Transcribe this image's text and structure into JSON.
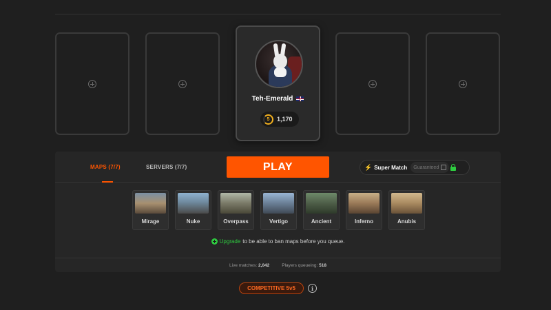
{
  "player": {
    "name": "Teh-Emerald",
    "flag": "uk-flag",
    "elo_level": "5",
    "elo": "1,170"
  },
  "empty_slots": 4,
  "queue": {
    "tabs": [
      {
        "label": "MAPS (7/7)",
        "active": true
      },
      {
        "label": "SERVERS (7/7)",
        "active": false
      }
    ],
    "play_label": "PLAY",
    "super_match": {
      "label": "Super Match",
      "guaranteed_label": "Guaranteed"
    },
    "maps": [
      {
        "name": "Mirage"
      },
      {
        "name": "Nuke"
      },
      {
        "name": "Overpass"
      },
      {
        "name": "Vertigo"
      },
      {
        "name": "Ancient"
      },
      {
        "name": "Inferno"
      },
      {
        "name": "Anubis"
      }
    ],
    "upgrade": {
      "link": "Upgrade",
      "text": "to be able to ban maps before you queue."
    },
    "stats": {
      "live_label": "Live matches:",
      "live_value": "2,042",
      "queue_label": "Players queueing:",
      "queue_value": "518"
    }
  },
  "mode": "COMPETITIVE 5v5",
  "colors": {
    "accent": "#ff5500",
    "success": "#2ecc40",
    "background": "#1f1f1f",
    "panel": "#262626"
  }
}
